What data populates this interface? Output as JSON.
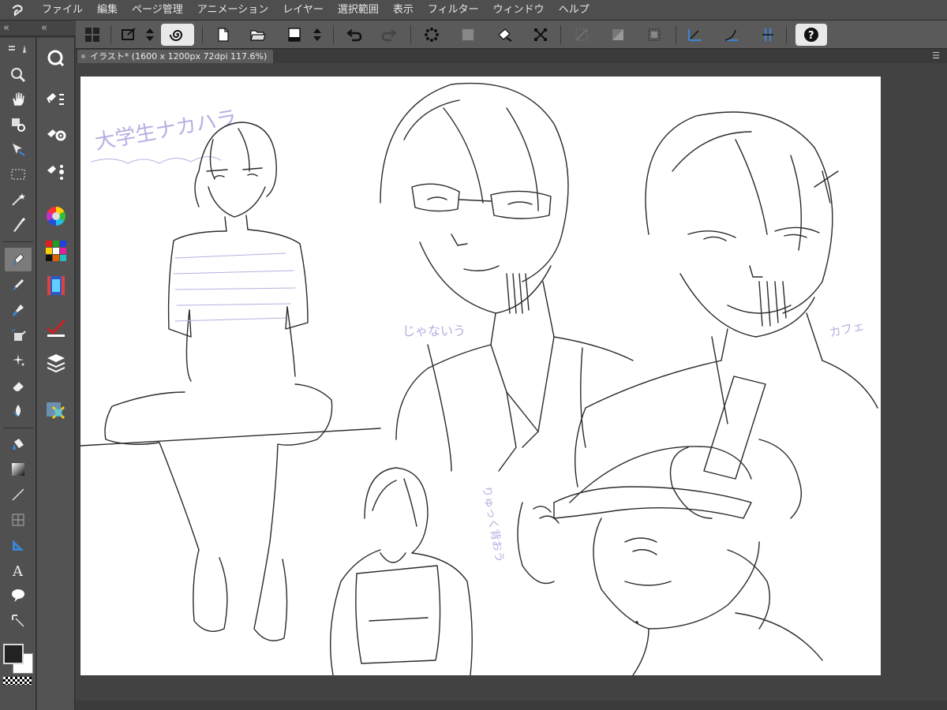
{
  "menu": {
    "items": [
      "ファイル",
      "編集",
      "ページ管理",
      "アニメーション",
      "レイヤー",
      "選択範囲",
      "表示",
      "フィルター",
      "ウィンドウ",
      "ヘルプ"
    ]
  },
  "tab": {
    "title": "イラスト* (1600 x 1200px 72dpi 117.6%)"
  },
  "toolbox": {
    "tools": [
      "zoom-icon",
      "hand-icon",
      "eyedropper-icon",
      "object-select-icon",
      "marquee-select-icon",
      "magic-wand-icon",
      "pen-icon",
      "pencil-icon",
      "brush-icon",
      "airbrush-icon",
      "decoration-icon",
      "eraser-icon",
      "blend-icon",
      "fill-icon",
      "gradient-icon",
      "line-icon",
      "frame-icon",
      "ruler-icon",
      "text-icon",
      "balloon-icon",
      "correct-line-icon"
    ],
    "active_tool": "pen-icon"
  },
  "colors": {
    "main": "#222222",
    "sub": "#ffffff",
    "accent": "#3a86d4"
  },
  "canvas_text": {
    "note_top_left": "大学生ナカハラ",
    "note_mid": "じゃないう",
    "note_right": "カフェ",
    "note_lower": "りゅっく背おう"
  }
}
